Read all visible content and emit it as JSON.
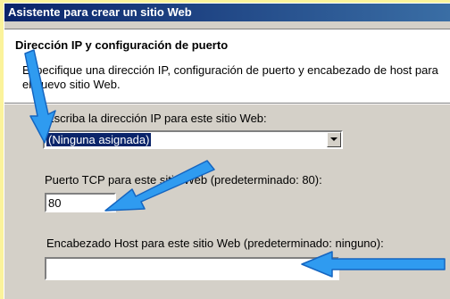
{
  "window": {
    "title": "Asistente para crear un sitio Web"
  },
  "header": {
    "title": "Dirección IP y configuración de puerto",
    "description": "Especifique una dirección IP, configuración de puerto y encabezado de host para el nuevo sitio Web."
  },
  "ip": {
    "label": "Escriba la dirección IP para este sitio Web:",
    "selected": "(Ninguna asignada)"
  },
  "port": {
    "label": "Puerto TCP para este sitio Web (predeterminado: 80):",
    "value": "80"
  },
  "host_header": {
    "label": "Encabezado Host para este sitio Web (predeterminado: ninguno):",
    "value": ""
  },
  "annotation_color": "#2f9bf0",
  "icons": {
    "dropdown": "chevron-down-icon",
    "pointer_arrows": "arrow-icon"
  }
}
